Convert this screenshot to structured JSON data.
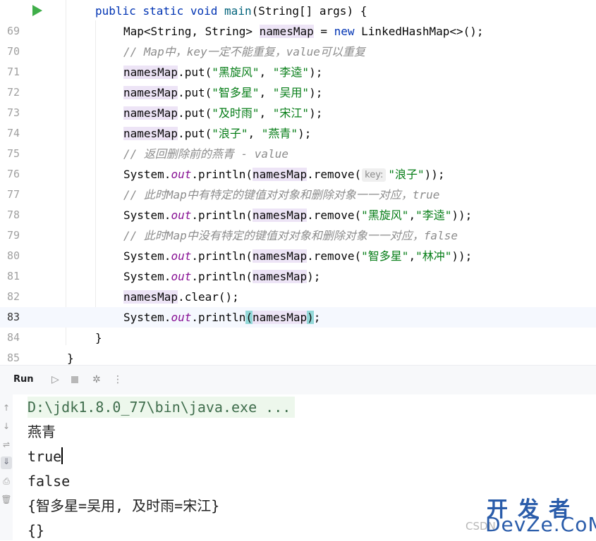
{
  "editor": {
    "lines": [
      {
        "num": "",
        "text": ""
      },
      {
        "num": "69",
        "text": ""
      },
      {
        "num": "70",
        "text": ""
      },
      {
        "num": "71",
        "text": ""
      },
      {
        "num": "72",
        "text": ""
      },
      {
        "num": "73",
        "text": ""
      },
      {
        "num": "74",
        "text": ""
      },
      {
        "num": "75",
        "text": ""
      },
      {
        "num": "76",
        "text": ""
      },
      {
        "num": "77",
        "text": ""
      },
      {
        "num": "78",
        "text": ""
      },
      {
        "num": "79",
        "text": ""
      },
      {
        "num": "80",
        "text": ""
      },
      {
        "num": "81",
        "text": ""
      },
      {
        "num": "82",
        "text": ""
      },
      {
        "num": "83",
        "text": ""
      },
      {
        "num": "84",
        "text": ""
      },
      {
        "num": "85",
        "text": ""
      }
    ],
    "current_line": "83",
    "tokens": {
      "public": "public",
      "static": "static",
      "void": "void",
      "main": "main",
      "main_sig": "(String[] args) {",
      "map_decl": "Map<String, String> ",
      "names_map": "namesMap",
      "assign": " = ",
      "new": "new",
      "linked": " LinkedHashMap<>();",
      "c70": "// Map中，key一定不能重复，value可以重复",
      "put": ".put(",
      "s_hxf": "\"黑旋风\"",
      "s_lk": "\"李逵\"",
      "s_zdx": "\"智多星\"",
      "s_wy": "\"吴用\"",
      "s_jsy": "\"及时雨\"",
      "s_sj": "\"宋江\"",
      "s_lz": "\"浪子\"",
      "s_yq": "\"燕青\"",
      "s_lc": "\"林冲\"",
      "comma_sp": ", ",
      "comma": ",",
      "close_stmt": ");",
      "close2": "));",
      "c75": "// 返回删除前的燕青 - value",
      "sys": "System.",
      "out": "out",
      "println": ".println(",
      "remove": ".remove(",
      "hint_key": "key:",
      "c77": "// 此时Map中有特定的键值对对象和删除对象一一对应，true",
      "c79": "// 此时Map中没有特定的键值对对象和删除对象一一对应，false",
      "clear": ".clear();",
      "paren_open": "(",
      "paren_close": ")",
      "semi": ";",
      "brace_close": "}"
    }
  },
  "run_panel": {
    "title": "Run",
    "icons": [
      "play-icon",
      "stop-icon",
      "debug-icon",
      "more-icon"
    ],
    "more_glyph": "⋮"
  },
  "console": {
    "lines": [
      "D:\\jdk1.8.0_77\\bin\\java.exe ...",
      "燕青",
      "true",
      "false",
      "{智多星=吴用, 及时雨=宋江}",
      "{}"
    ]
  },
  "watermark": {
    "csdn": "CSDN",
    "cn": "开发者",
    "en": "DevZe.CoM"
  }
}
